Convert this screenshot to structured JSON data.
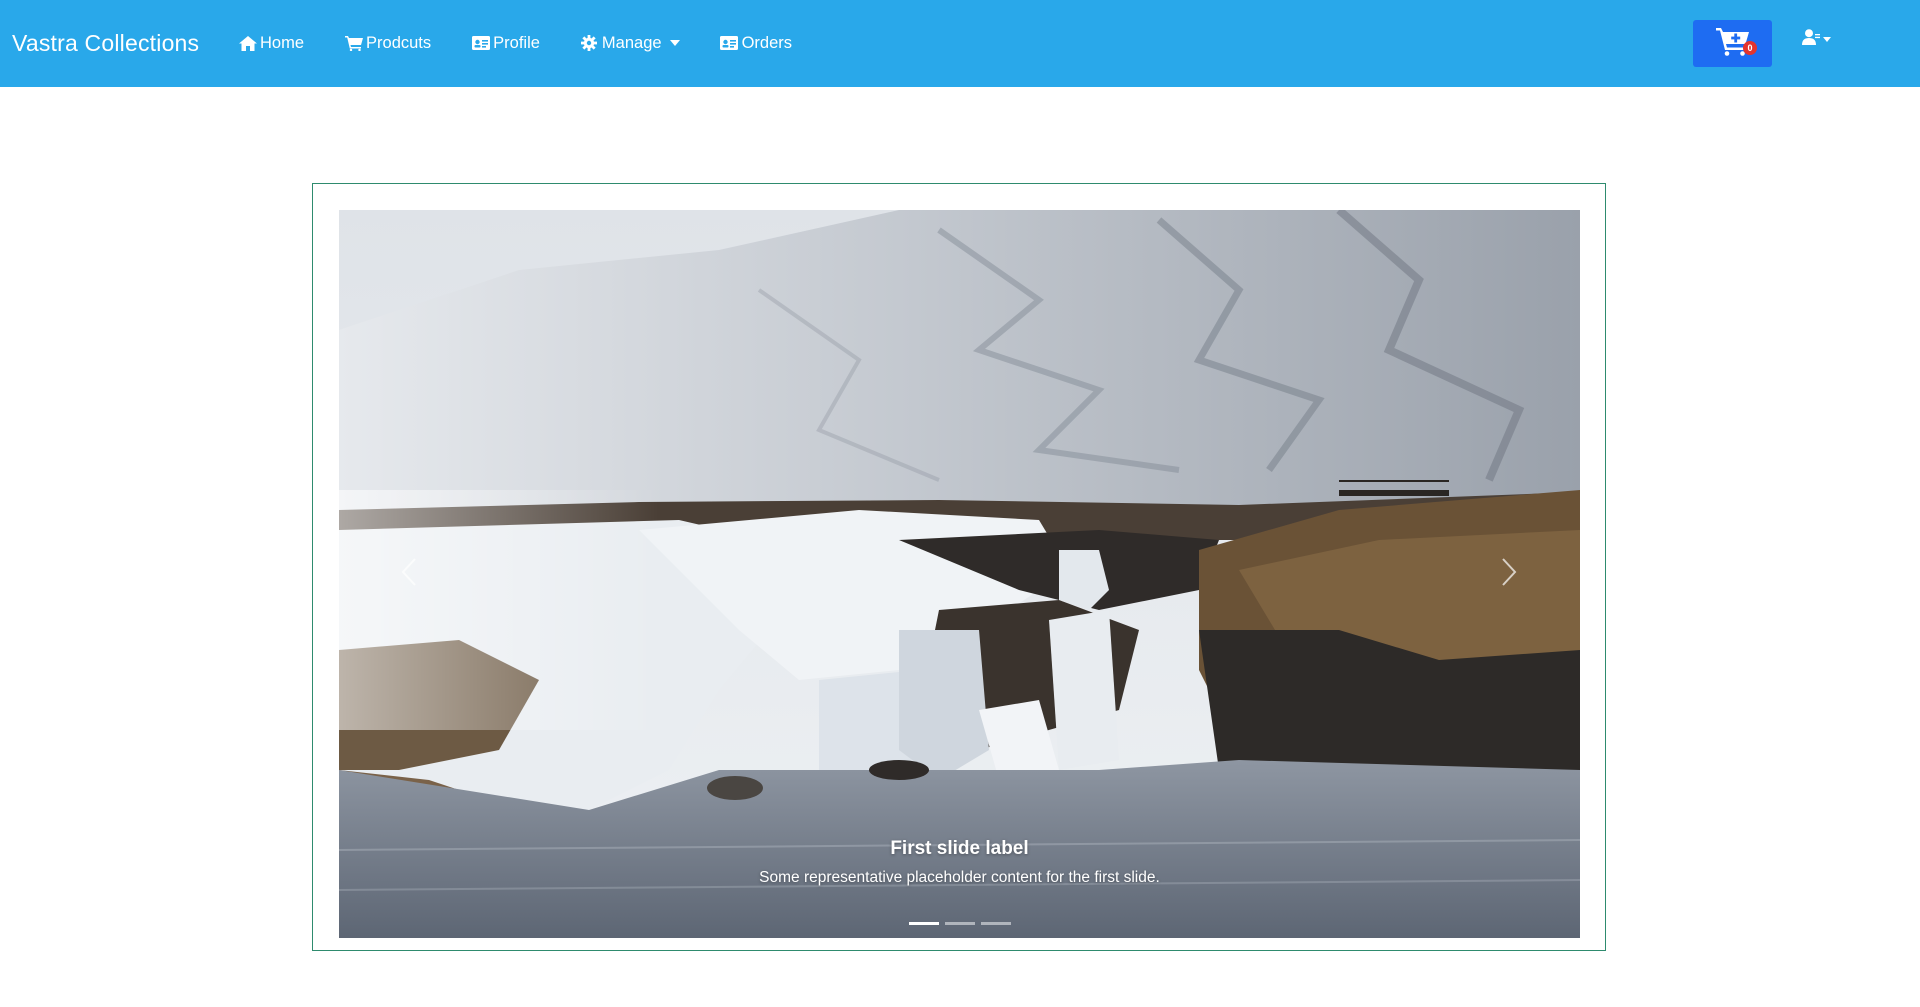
{
  "navbar": {
    "brand": "Vastra Collections",
    "background_color": "#29a8ea",
    "links": [
      {
        "label": "Home",
        "icon": "home-icon"
      },
      {
        "label": "Prodcuts",
        "icon": "cart-icon"
      },
      {
        "label": "Profile",
        "icon": "id-card-icon"
      },
      {
        "label": "Manage",
        "icon": "gear-icon",
        "dropdown": true
      },
      {
        "label": "Orders",
        "icon": "id-card-icon"
      }
    ],
    "cart": {
      "icon": "cart-plus-icon",
      "count": "0",
      "button_color": "#1e6cf2",
      "badge_color": "#e3342f"
    },
    "user_menu": {
      "icon": "user-icon",
      "dropdown": true
    }
  },
  "carousel": {
    "border_color": "#2e8b6e",
    "slides_total": 3,
    "active_slide": 1,
    "caption_title": "First slide label",
    "caption_text": "Some representative placeholder content for the first slide.",
    "image_description_icon": "waterfall-landscape-image",
    "prev_icon": "chevron-left-icon",
    "next_icon": "chevron-right-icon"
  }
}
